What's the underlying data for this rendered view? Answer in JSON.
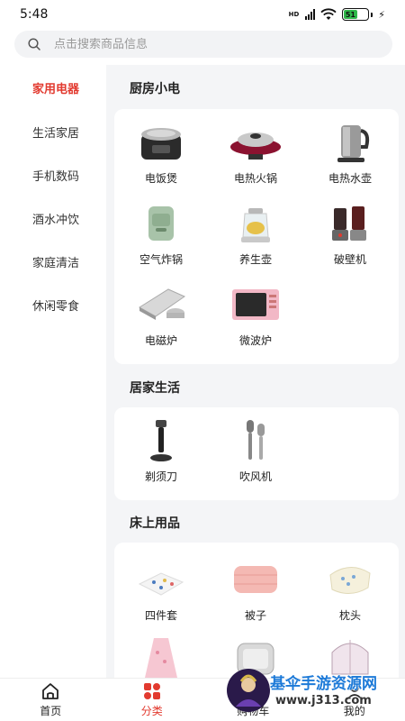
{
  "status_bar": {
    "time": "5:48",
    "network": "HD",
    "battery": "51"
  },
  "search": {
    "placeholder": "点击搜索商品信息"
  },
  "categories": [
    {
      "label": "家用电器",
      "active": true
    },
    {
      "label": "生活家居",
      "active": false
    },
    {
      "label": "手机数码",
      "active": false
    },
    {
      "label": "酒水冲饮",
      "active": false
    },
    {
      "label": "家庭清洁",
      "active": false
    },
    {
      "label": "休闲零食",
      "active": false
    }
  ],
  "sections": [
    {
      "title": "厨房小电",
      "items": [
        "电饭煲",
        "电热火锅",
        "电热水壶",
        "空气炸锅",
        "养生壶",
        "破壁机",
        "电磁炉",
        "微波炉"
      ]
    },
    {
      "title": "居家生活",
      "items": [
        "剃须刀",
        "吹风机"
      ]
    },
    {
      "title": "床上用品",
      "items": [
        "四件套",
        "被子",
        "枕头"
      ]
    }
  ],
  "bottom_nav": [
    {
      "label": "首页",
      "icon": "home-icon",
      "active": false
    },
    {
      "label": "分类",
      "icon": "category-icon",
      "active": true
    },
    {
      "label": "购物车",
      "icon": "cart-icon",
      "active": false
    },
    {
      "label": "我的",
      "icon": "profile-icon",
      "active": false
    }
  ],
  "watermark": {
    "title": "基伞手游资源网",
    "url": "www.j313.com"
  },
  "colors": {
    "accent": "#e23a2f",
    "background": "#f4f5f7",
    "watermark": "#1d7ad8"
  }
}
